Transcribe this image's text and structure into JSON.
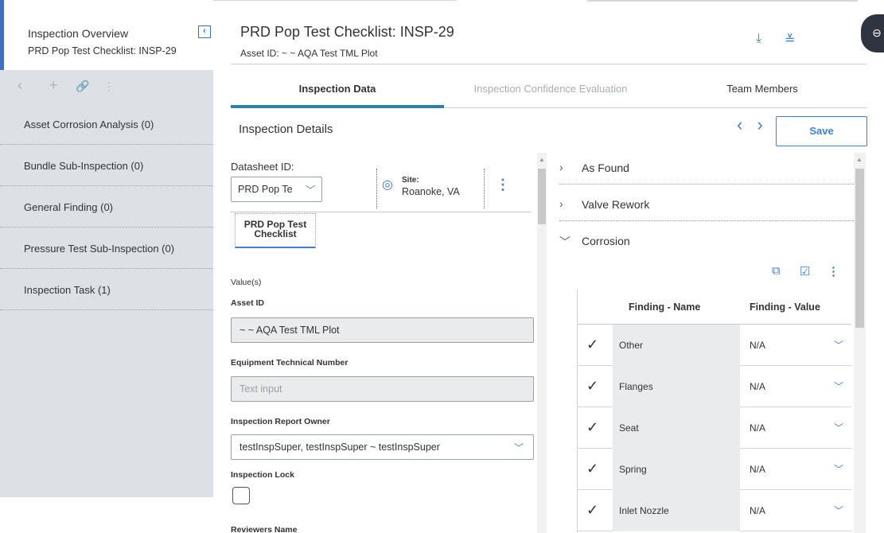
{
  "left": {
    "header_title": "Inspection Overview",
    "header_subtitle": "PRD Pop Test Checklist: INSP-29",
    "collapse_icon": "chevron-left-box",
    "toolbar_icons": [
      "back-icon",
      "plus-icon",
      "link-icon",
      "kebab-icon"
    ],
    "items": [
      {
        "label": "Asset Corrosion Analysis (0)"
      },
      {
        "label": "Bundle Sub-Inspection (0)"
      },
      {
        "label": "General Finding (0)"
      },
      {
        "label": "Pressure Test Sub-Inspection (0)"
      },
      {
        "label": "Inspection Task (1)"
      }
    ]
  },
  "header": {
    "title": "PRD Pop Test Checklist: INSP-29",
    "subtitle": "Asset ID: ~ ~ AQA Test TML Plot",
    "icons": [
      "download-icon",
      "compare-icon",
      "side-panel-toggle-icon"
    ]
  },
  "tabs": [
    {
      "label": "Inspection Data",
      "active": true
    },
    {
      "label": "Inspection Confidence Evaluation",
      "active": false
    },
    {
      "label": "Team Members",
      "active": false
    }
  ],
  "section": {
    "title": "Inspection Details",
    "nav_arrows": "‹ ›",
    "save_label": "Save"
  },
  "datasheet": {
    "label": "Datasheet ID:",
    "selected": "PRD Pop Te",
    "site_label": "Site:",
    "site_value": "Roanoke, VA",
    "tab_label": "PRD Pop Test Checklist",
    "values_label": "Value(s)",
    "fields": {
      "asset_id_label": "Asset ID",
      "asset_id_value": "~ ~ AQA Test TML Plot",
      "etn_label": "Equipment Technical Number",
      "etn_placeholder": "Text input",
      "owner_label": "Inspection Report Owner",
      "owner_value": "testInspSuper, testInspSuper ~ testInspSuper",
      "lock_label": "Inspection Lock",
      "lock_checked": false,
      "reviewers_label": "Reviewers Name"
    }
  },
  "findings": {
    "accordions": [
      {
        "label": "As Found",
        "expanded": false
      },
      {
        "label": "Valve Rework",
        "expanded": false
      },
      {
        "label": "Corrosion",
        "expanded": true
      }
    ],
    "tools": [
      "copy-icon",
      "check-square-icon",
      "kebab-icon"
    ],
    "columns": [
      "Finding - Name",
      "Finding - Value"
    ],
    "rows": [
      {
        "name": "Other",
        "value": "N/A"
      },
      {
        "name": "Flanges",
        "value": "N/A"
      },
      {
        "name": "Seat",
        "value": "N/A"
      },
      {
        "name": "Spring",
        "value": "N/A"
      },
      {
        "name": "Inlet Nozzle",
        "value": "N/A"
      }
    ]
  },
  "colors": {
    "accent": "#3f7fd0",
    "tab_underline": "#2f7fa6",
    "sidebar_bg": "#dde0e5",
    "header_bar": "#3f6fc0"
  }
}
